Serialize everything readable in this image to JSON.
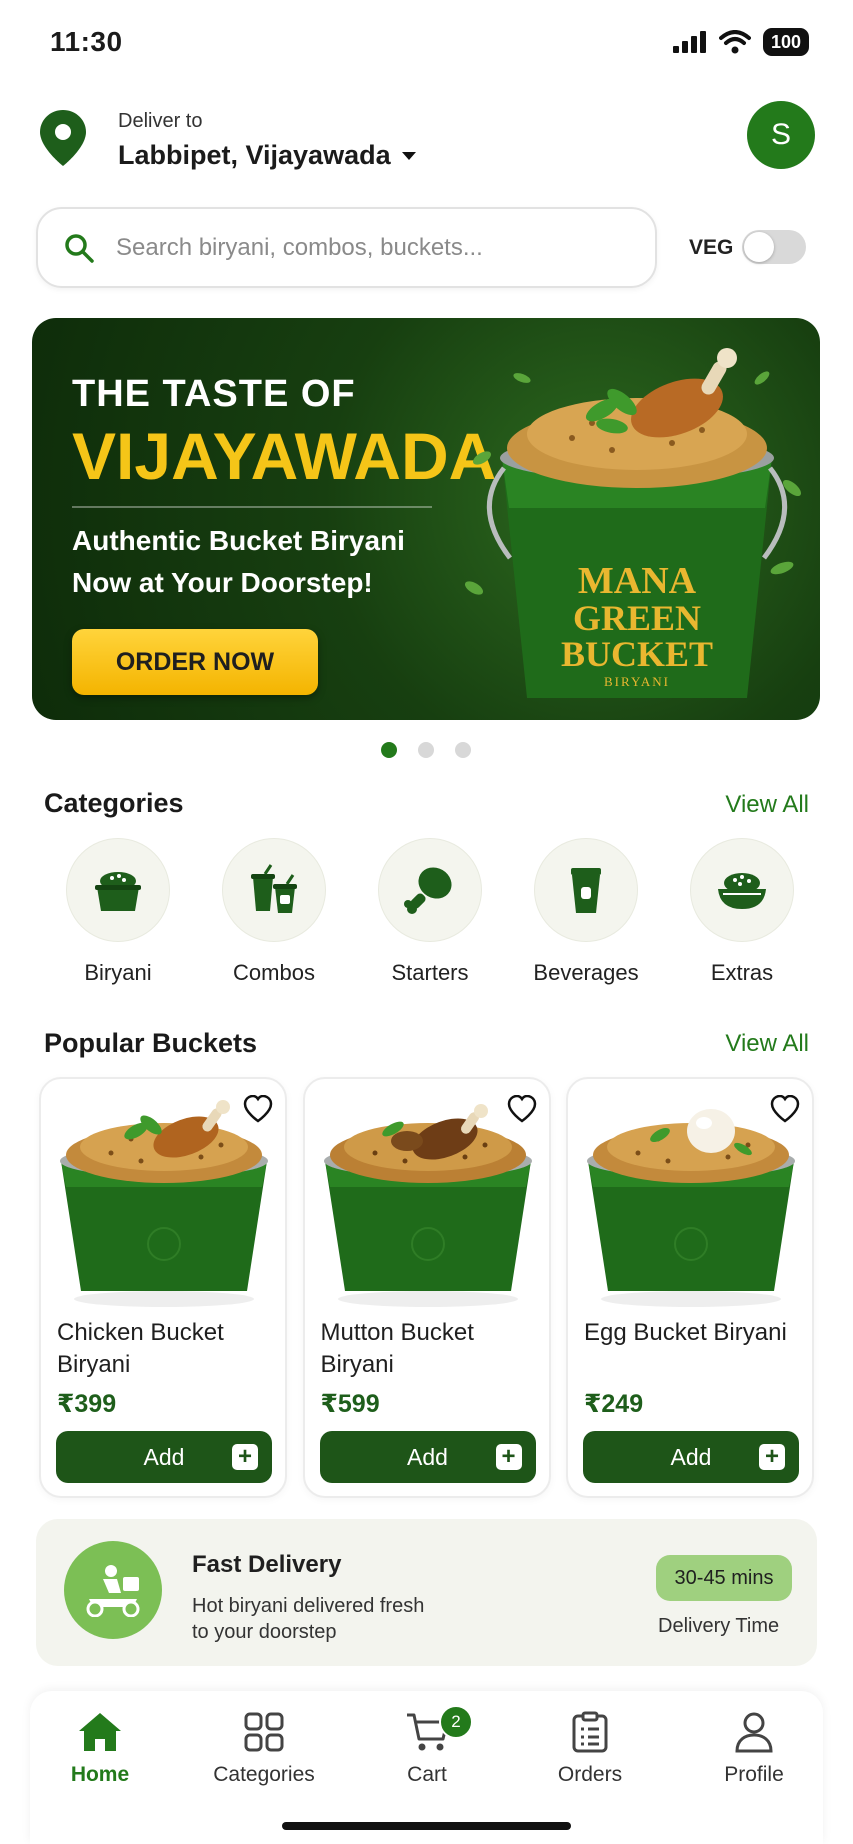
{
  "status_bar": {
    "time": "11:30",
    "battery": "100"
  },
  "header": {
    "deliver_label": "Deliver to",
    "location": "Labbipet, Vijayawada",
    "avatar_initial": "S"
  },
  "search": {
    "placeholder": "Search biryani, combos, buckets...",
    "veg_label": "VEG"
  },
  "banner": {
    "line1": "THE TASTE OF",
    "line2": "VIJAYAWADA",
    "subtitle": "Authentic Bucket Biryani Now at Your Doorstep!",
    "cta": "ORDER NOW",
    "bucket_brand_1": "MANA",
    "bucket_brand_2": "GREEN",
    "bucket_brand_3": "BUCKET",
    "bucket_brand_4": "BIRYANI"
  },
  "categories": {
    "title": "Categories",
    "view_all": "View All",
    "items": [
      {
        "label": "Biryani",
        "icon": "biryani-pot-icon"
      },
      {
        "label": "Combos",
        "icon": "combo-cups-icon"
      },
      {
        "label": "Starters",
        "icon": "chicken-leg-icon"
      },
      {
        "label": "Beverages",
        "icon": "beverage-cup-icon"
      },
      {
        "label": "Extras",
        "icon": "rice-bowl-icon"
      }
    ]
  },
  "popular": {
    "title": "Popular Buckets",
    "view_all": "View All",
    "items": [
      {
        "name": "Chicken Bucket Biryani",
        "price": "₹399",
        "add_label": "Add"
      },
      {
        "name": "Mutton Bucket Biryani",
        "price": "₹599",
        "add_label": "Add"
      },
      {
        "name": "Egg Bucket Biryani",
        "price": "₹249",
        "add_label": "Add"
      }
    ]
  },
  "delivery": {
    "title": "Fast Delivery",
    "description": "Hot biryani delivered fresh to your doorstep",
    "time": "30-45 mins",
    "time_label": "Delivery Time"
  },
  "nav": {
    "items": [
      {
        "label": "Home",
        "icon": "home-icon",
        "active": true
      },
      {
        "label": "Categories",
        "icon": "grid-icon",
        "active": false
      },
      {
        "label": "Cart",
        "icon": "cart-icon",
        "active": false
      },
      {
        "label": "Orders",
        "icon": "clipboard-icon",
        "active": false
      },
      {
        "label": "Profile",
        "icon": "user-icon",
        "active": false
      }
    ],
    "cart_count": "2"
  },
  "colors": {
    "brand_green": "#237a1b",
    "dark_green": "#1e5518",
    "banner_accent": "#f5c518",
    "light_green": "#9fd07f"
  }
}
